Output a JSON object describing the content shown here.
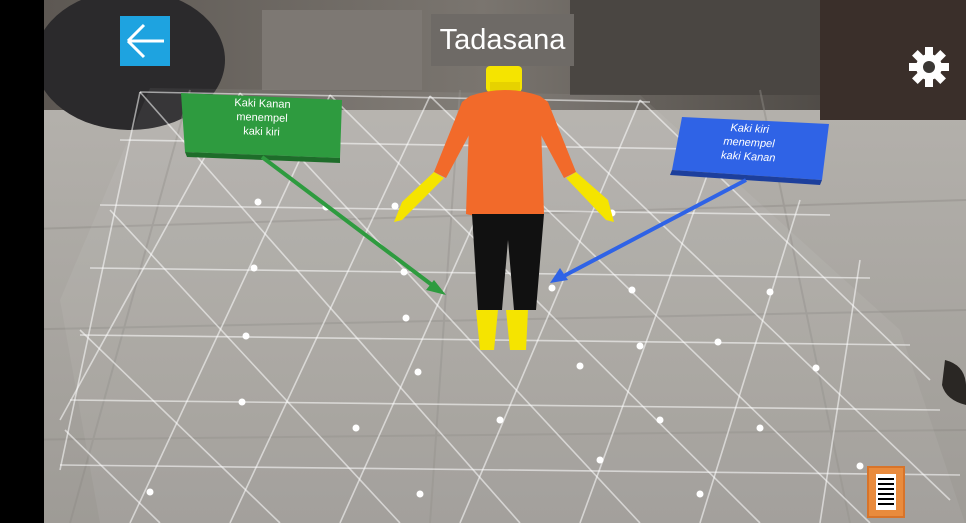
{
  "header": {
    "title": "Tadasana"
  },
  "toolbar": {
    "back_icon": "arrow-left-icon",
    "settings_icon": "gear-icon",
    "menu_icon": "list-icon"
  },
  "callouts": {
    "right_foot": {
      "text": "Kaki Kanan\nmenempel\nkaki kiri",
      "color": "#2e9b3f"
    },
    "left_foot": {
      "text": "Kaki kiri\nmenempel\nkaki Kanan",
      "color": "#2f63e6"
    }
  },
  "colors": {
    "accent_back": "#1ea3e0",
    "menu_button": "#e98b3d",
    "figure_torso": "#f26a2a",
    "figure_limbs": "#f5e400",
    "figure_legs": "#111111"
  }
}
